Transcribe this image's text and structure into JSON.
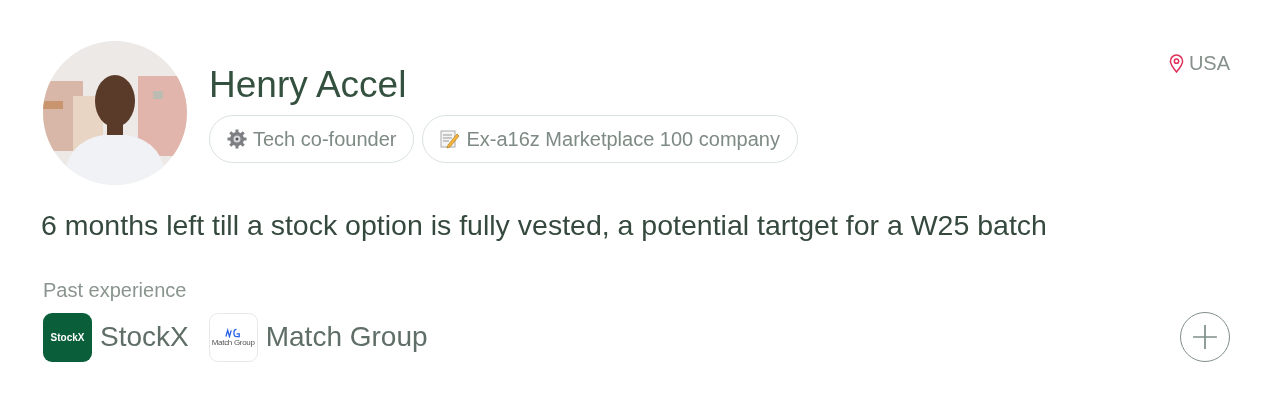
{
  "profile": {
    "name": "Henry Accel",
    "location": "USA"
  },
  "tags": [
    {
      "kind": "gear",
      "label": "Tech co-founder"
    },
    {
      "kind": "memo",
      "label": "Ex-a16z Marketplace 100 company"
    }
  ],
  "summary": "6 months left till a stock option is fully vested, a potential tartget for a W25 batch",
  "past_experience": {
    "label": "Past experience",
    "companies": [
      {
        "kind": "stockx",
        "logo_text": "StockX",
        "name": "StockX"
      },
      {
        "kind": "match",
        "logo_text": "Match Group",
        "name": "Match Group"
      }
    ]
  }
}
